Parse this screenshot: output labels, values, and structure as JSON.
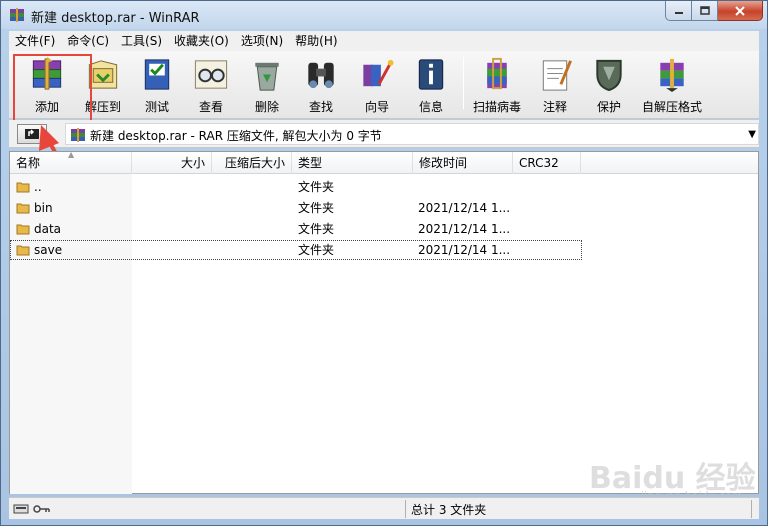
{
  "window": {
    "title": "新建 desktop.rar - WinRAR"
  },
  "menu": [
    {
      "label": "文件(F)"
    },
    {
      "label": "命令(C)"
    },
    {
      "label": "工具(S)"
    },
    {
      "label": "收藏夹(O)"
    },
    {
      "label": "选项(N)"
    },
    {
      "label": "帮助(H)"
    }
  ],
  "toolbar": [
    {
      "label": "添加",
      "icon": "add-books-icon"
    },
    {
      "label": "解压到",
      "icon": "extract-icon"
    },
    {
      "label": "测试",
      "icon": "test-icon"
    },
    {
      "label": "查看",
      "icon": "view-glasses-icon"
    },
    {
      "label": "删除",
      "icon": "delete-recycle-icon"
    },
    {
      "label": "查找",
      "icon": "find-binoculars-icon"
    },
    {
      "label": "向导",
      "icon": "wizard-icon"
    },
    {
      "label": "信息",
      "icon": "info-icon"
    },
    {
      "label": "扫描病毒",
      "icon": "virus-scan-icon"
    },
    {
      "label": "注释",
      "icon": "comment-icon"
    },
    {
      "label": "保护",
      "icon": "protect-shield-icon"
    },
    {
      "label": "自解压格式",
      "icon": "sfx-icon"
    }
  ],
  "address": {
    "text": "新建 desktop.rar - RAR 压缩文件, 解包大小为 0 字节"
  },
  "columns": [
    {
      "label": "名称"
    },
    {
      "label": "大小"
    },
    {
      "label": "压缩后大小"
    },
    {
      "label": "类型"
    },
    {
      "label": "修改时间"
    },
    {
      "label": "CRC32"
    }
  ],
  "files": [
    {
      "name": "..",
      "type": "文件夹",
      "modified": ""
    },
    {
      "name": "bin",
      "type": "文件夹",
      "modified": "2021/12/14 1..."
    },
    {
      "name": "data",
      "type": "文件夹",
      "modified": "2021/12/14 1..."
    },
    {
      "name": "save",
      "type": "文件夹",
      "modified": "2021/12/14 1..."
    }
  ],
  "status": {
    "summary": "总计 3 文件夹"
  },
  "watermark": {
    "main": "Baidu 经验",
    "sub": "jingyan.baidu.com"
  },
  "colors": {
    "highlight": "#e8463c",
    "folder": "#e8b84a",
    "title_bar": "#c3d6ec"
  }
}
